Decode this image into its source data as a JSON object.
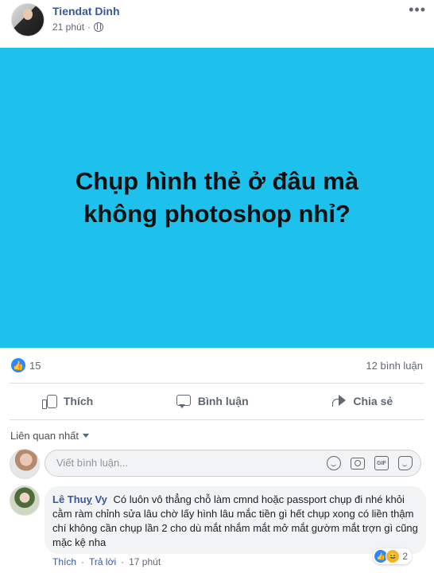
{
  "post": {
    "author": "Tiendat Dinh",
    "time": "21 phút",
    "separator": "·",
    "image_text": "Chụp hình thẻ ở đâu mà không photoshop nhỉ?",
    "image_bg": "#1ec1ec",
    "more_icon": "more-dots-icon"
  },
  "stats": {
    "like_count": "15",
    "comment_count": "12 bình luận"
  },
  "actions": {
    "like": "Thích",
    "comment": "Bình luận",
    "share": "Chia sẻ"
  },
  "comments_section": {
    "sort_label": "Liên quan nhất",
    "composer_placeholder": "Viết bình luận...",
    "composer_icons": [
      "emoji-icon",
      "camera-icon",
      "gif-icon",
      "sticker-icon"
    ],
    "gif_text": "GIF"
  },
  "comment": {
    "author": "Lê Thuỵ Vy",
    "text": "Có luôn vô thẳng chỗ làm cmnd hoặc passport chụp đi nhé khỏi cằm ràm chỉnh sửa lâu chờ lấy hình lâu mắc tiền gì hết chụp xong có liền thậm chí không cần chụp lần 2 cho dù mắt nhắm mắt mở mắt gườm mắt trợn gì cũng mặc kệ nha",
    "reaction_count": "2",
    "like_label": "Thích",
    "reply_label": "Trả lời",
    "time": "17 phút",
    "dot": "·"
  },
  "colors": {
    "link_blue": "#385898",
    "like_blue": "#2d88ff"
  }
}
